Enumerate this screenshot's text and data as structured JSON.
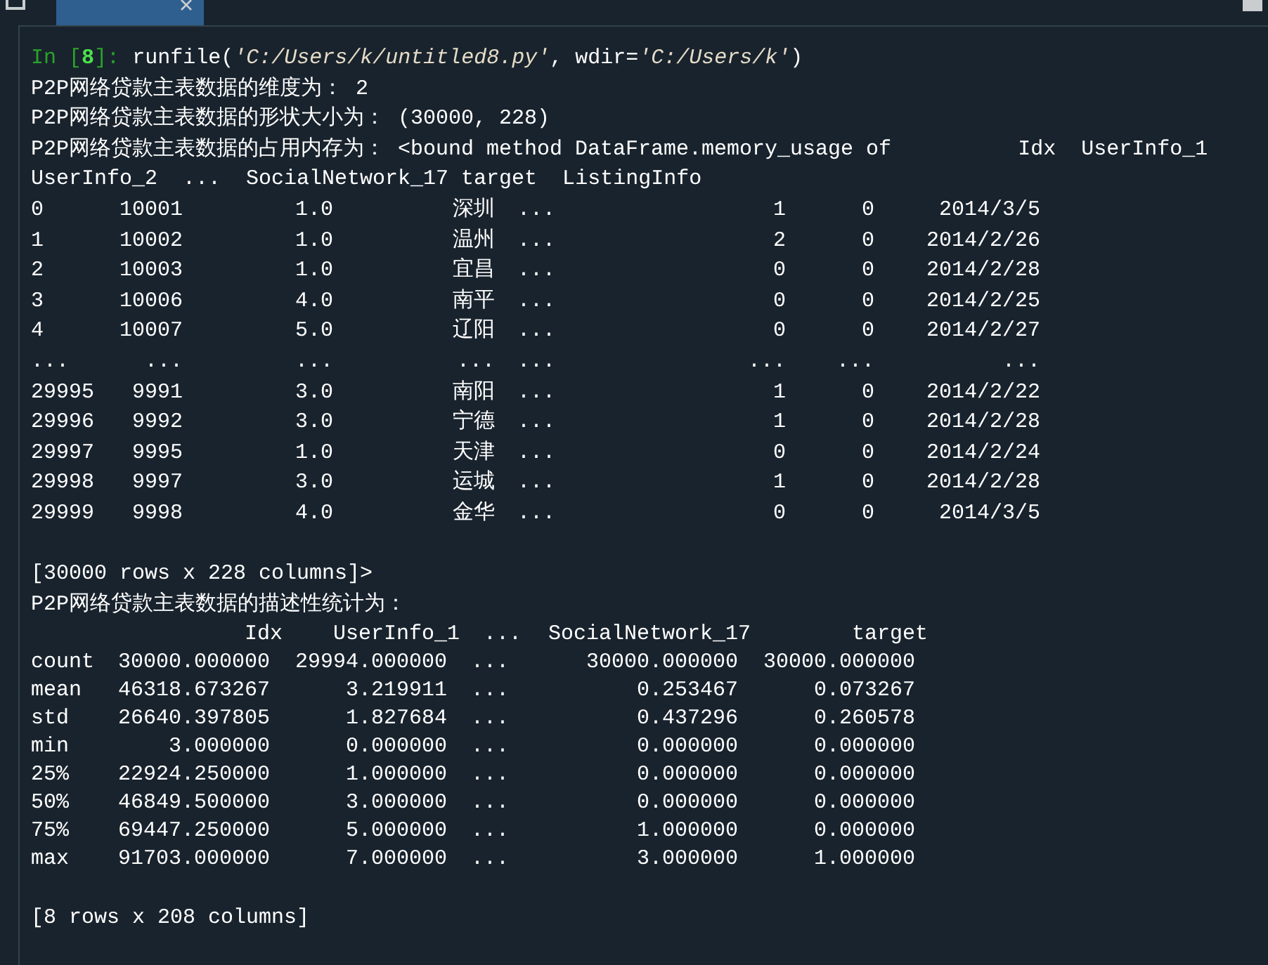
{
  "tab": {
    "selected": true
  },
  "input": {
    "prompt_start": "In [",
    "number": "8",
    "prompt_end": "]:",
    "code": [
      {
        "kind": "code",
        "text": "runfile("
      },
      {
        "kind": "string",
        "text": "'C:/Users/k/untitled8.py'"
      },
      {
        "kind": "code",
        "text": ", wdir="
      },
      {
        "kind": "string",
        "text": "'C:/Users/k'"
      },
      {
        "kind": "code",
        "text": ")"
      }
    ]
  },
  "output": [
    {
      "kind": "text",
      "text": "P2P网络贷款主表数据的维度为： 2"
    },
    {
      "kind": "text",
      "text": "P2P网络贷款主表数据的形状大小为： (30000, 228)"
    },
    {
      "kind": "text",
      "text": "P2P网络贷款主表数据的占用内存为： <bound method DataFrame.memory_usage of          Idx  UserInfo_1"
    },
    {
      "kind": "text",
      "text": "UserInfo_2  ...  SocialNetwork_17 target  ListingInfo"
    },
    {
      "kind": "table",
      "rows": [
        [
          "0",
          "10001",
          "1.0",
          "深圳",
          "...",
          "1",
          "0",
          "2014/3/5"
        ],
        [
          "1",
          "10002",
          "1.0",
          "温州",
          "...",
          "2",
          "0",
          "2014/2/26"
        ],
        [
          "2",
          "10003",
          "1.0",
          "宜昌",
          "...",
          "0",
          "0",
          "2014/2/28"
        ],
        [
          "3",
          "10006",
          "4.0",
          "南平",
          "...",
          "0",
          "0",
          "2014/2/25"
        ],
        [
          "4",
          "10007",
          "5.0",
          "辽阳",
          "...",
          "0",
          "0",
          "2014/2/27"
        ],
        [
          "...",
          "...",
          "...",
          "...",
          "...",
          "...",
          "...",
          "..."
        ],
        [
          "29995",
          "9991",
          "3.0",
          "南阳",
          "...",
          "1",
          "0",
          "2014/2/22"
        ],
        [
          "29996",
          "9992",
          "3.0",
          "宁德",
          "...",
          "1",
          "0",
          "2014/2/28"
        ],
        [
          "29997",
          "9995",
          "1.0",
          "天津",
          "...",
          "0",
          "0",
          "2014/2/24"
        ],
        [
          "29998",
          "9997",
          "3.0",
          "运城",
          "...",
          "1",
          "0",
          "2014/2/28"
        ],
        [
          "29999",
          "9998",
          "4.0",
          "金华",
          "...",
          "0",
          "0",
          "2014/3/5"
        ]
      ]
    },
    {
      "kind": "blank"
    },
    {
      "kind": "text",
      "text": "[30000 rows x 228 columns]>"
    },
    {
      "kind": "text",
      "text": "P2P网络贷款主表数据的描述性统计为："
    },
    {
      "kind": "stats",
      "columns": [
        "Idx",
        "UserInfo_1",
        "...",
        "SocialNetwork_17",
        "target"
      ],
      "rows": [
        {
          "label": "count",
          "values": [
            "30000.000000",
            "29994.000000",
            "...",
            "30000.000000",
            "30000.000000"
          ]
        },
        {
          "label": "mean",
          "values": [
            "46318.673267",
            "3.219911",
            "...",
            "0.253467",
            "0.073267"
          ]
        },
        {
          "label": "std",
          "values": [
            "26640.397805",
            "1.827684",
            "...",
            "0.437296",
            "0.260578"
          ]
        },
        {
          "label": "min",
          "values": [
            "3.000000",
            "0.000000",
            "...",
            "0.000000",
            "0.000000"
          ]
        },
        {
          "label": "25%",
          "values": [
            "22924.250000",
            "1.000000",
            "...",
            "0.000000",
            "0.000000"
          ]
        },
        {
          "label": "50%",
          "values": [
            "46849.500000",
            "3.000000",
            "...",
            "0.000000",
            "0.000000"
          ]
        },
        {
          "label": "75%",
          "values": [
            "69447.250000",
            "5.000000",
            "...",
            "1.000000",
            "0.000000"
          ]
        },
        {
          "label": "max",
          "values": [
            "91703.000000",
            "7.000000",
            "...",
            "3.000000",
            "1.000000"
          ]
        }
      ]
    },
    {
      "kind": "blank"
    },
    {
      "kind": "text",
      "text": "[8 rows x 208 columns]"
    }
  ]
}
